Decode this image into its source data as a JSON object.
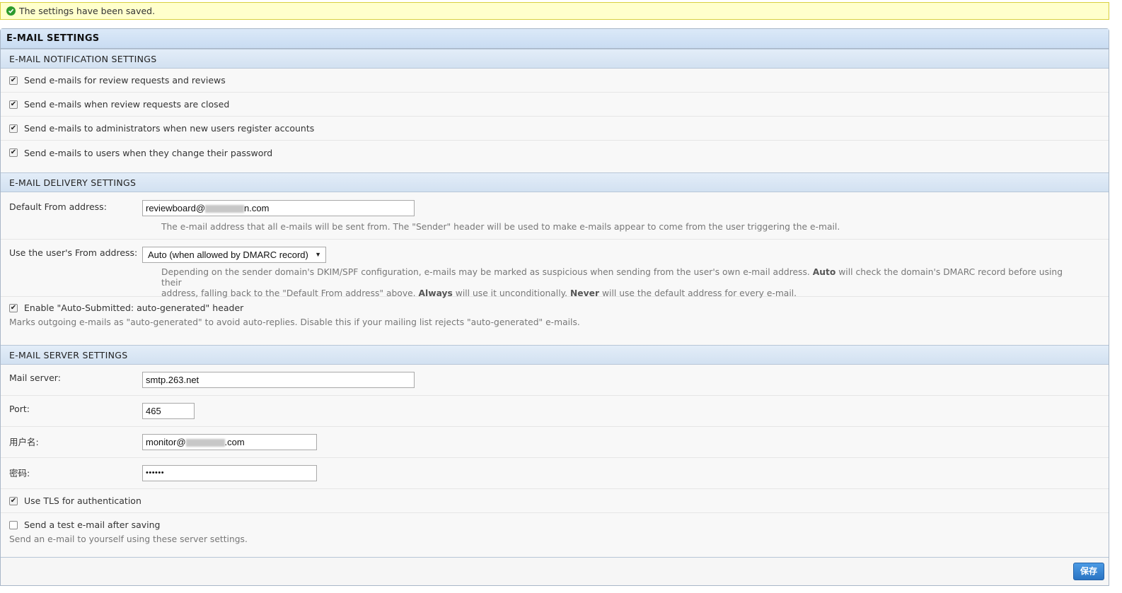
{
  "notice": {
    "text": "The settings have been saved.",
    "icon": "check-circle-icon",
    "color": "#ffffcc"
  },
  "panel": {
    "title": "E-MAIL SETTINGS"
  },
  "notifications": {
    "heading": "E-MAIL NOTIFICATION SETTINGS",
    "items": [
      {
        "label": "Send e-mails for review requests and reviews",
        "checked": true
      },
      {
        "label": "Send e-mails when review requests are closed",
        "checked": true
      },
      {
        "label": "Send e-mails to administrators when new users register accounts",
        "checked": true
      },
      {
        "label": "Send e-mails to users when they change their password",
        "checked": true
      }
    ]
  },
  "delivery": {
    "heading": "E-MAIL DELIVERY SETTINGS",
    "from_label": "Default From address:",
    "from_value_prefix": "reviewboard@",
    "from_value_suffix": "n.com",
    "from_help": "The e-mail address that all e-mails will be sent from. The \"Sender\" header will be used to make e-mails appear to come from the user triggering the e-mail.",
    "user_from_label": "Use the user's From address:",
    "user_from_value": "Auto (when allowed by DMARC record)",
    "user_from_help": {
      "part1": "Depending on the sender domain's DKIM/SPF configuration, e-mails may be marked as suspicious when sending from the user's own e-mail address.",
      "auto": "Auto",
      "part2": "will check the domain's DMARC record before using their",
      "part3": "address, falling back to the \"Default From address\" above.",
      "always": "Always",
      "part4": "will use it unconditionally.",
      "never": "Never",
      "part5": "will use the default address for every e-mail."
    },
    "auto_submitted_label": "Enable \"Auto-Submitted: auto-generated\" header",
    "auto_submitted_checked": true,
    "auto_submitted_help": "Marks outgoing e-mails as \"auto-generated\" to avoid auto-replies. Disable this if your mailing list rejects \"auto-generated\" e-mails."
  },
  "server": {
    "heading": "E-MAIL SERVER SETTINGS",
    "mail_server_label": "Mail server:",
    "mail_server_value": "smtp.263.net",
    "port_label": "Port:",
    "port_value": "465",
    "username_label": "用户名:",
    "username_prefix": "monitor@",
    "username_suffix": ".com",
    "password_label": "密码:",
    "password_value": "••••••",
    "tls_label": "Use TLS for authentication",
    "tls_checked": true,
    "test_label": "Send a test e-mail after saving",
    "test_checked": false,
    "test_help": "Send an e-mail to yourself using these server settings."
  },
  "footer": {
    "save_label": "保存",
    "save_color": "#2a74c3"
  }
}
